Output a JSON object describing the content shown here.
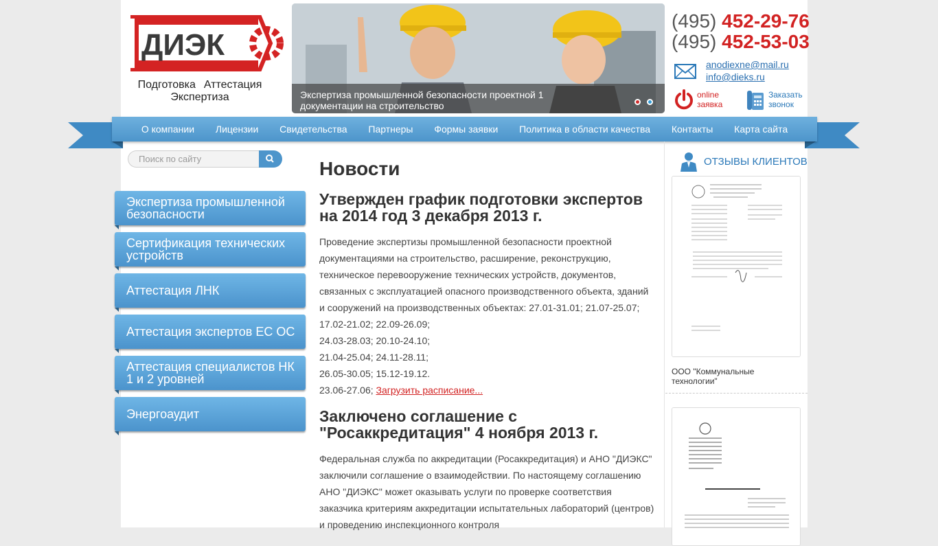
{
  "header": {
    "logo_text": "ДИЭКС",
    "slogan": [
      "Подготовка",
      "Аттестация",
      "Экспертиза"
    ],
    "banner": {
      "caption": "Экспертиза промышленной безопасности проектной 1 документации на строительство"
    },
    "phones": [
      {
        "code": "(495)",
        "number": "452-29-76"
      },
      {
        "code": "(495)",
        "number": "452-53-03"
      }
    ],
    "emails": [
      "anodiexne@mail.ru",
      "info@dieks.ru"
    ],
    "online_request": "online заявка",
    "callback": "Заказать звонок"
  },
  "nav": {
    "items": [
      "О компании",
      "Лицензии",
      "Свидетельства",
      "Партнеры",
      "Формы заявки",
      "Политика в области качества",
      "Контакты",
      "Карта сайта"
    ]
  },
  "sidebar": {
    "search_placeholder": "Поиск по сайту",
    "menu": [
      "Экспертиза промышленной безопасности",
      "Сертификация технических устройств",
      "Аттестация ЛНК",
      "Аттестация экспертов ЕС ОС",
      "Аттестация специалистов НК 1 и 2 уровней",
      "Энергоаудит"
    ]
  },
  "main": {
    "title": "Новости",
    "news": [
      {
        "title": "Утвержден график подготовки экспертов на 2014 год 3 декабря 2013 г.",
        "body": "Проведение экспертизы промышленной безопасности проектной документациями на строительство, расширение, реконструкцию, техническое перевооружение технических устройств, документов, связанных с эксплуатацией опасного производственного объекта, зданий и сооружений на производственных объектах: 27.01-31.01; 21.07-25.07; 17.02-21.02; 22.09-26.09;",
        "lines": [
          "24.03-28.03; 20.10-24.10;",
          "21.04-25.04; 24.11-28.11;",
          "26.05-30.05; 15.12-19.12."
        ],
        "last_line": "23.06-27.06;",
        "link": "Загрузить расписание..."
      },
      {
        "title": "Заключено соглашение с \"Росаккредитация\" 4 ноября 2013 г.",
        "body": "Федеральная служба по аккредитации (Росаккредитация) и АНО \"ДИЭКС\" заключили соглашение о взаимодействии. По настоящему соглашению АНО \"ДИЭКС\" может оказывать услуги по проверке соответствия заказчика критериям аккредитации испытательных лабораторий (центров) и проведению инспекционного контроля"
      }
    ]
  },
  "reviews": {
    "title": "ОТЗЫВЫ КЛИЕНТОВ",
    "items": [
      {
        "company": "ООО \"Коммунальные технологии\""
      },
      {
        "company": ""
      }
    ]
  },
  "colors": {
    "accent": "#4d95cb",
    "phone": "#d22222",
    "link": "#2a78b8"
  }
}
